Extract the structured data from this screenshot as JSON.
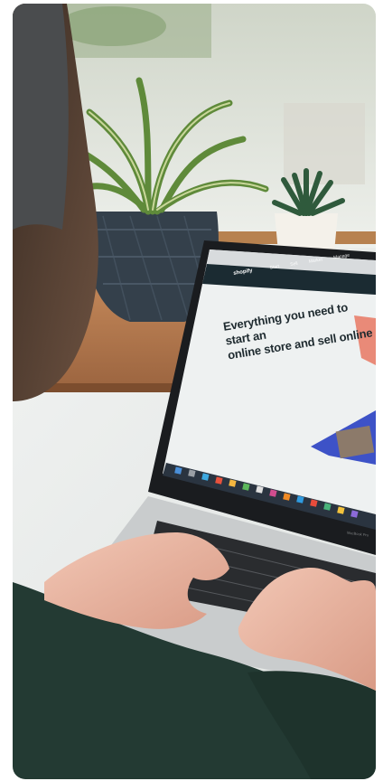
{
  "photo": {
    "subject": "laptop-on-desk-photo",
    "screen": {
      "brand": "shopify",
      "nav": [
        "Start",
        "Sell",
        "Market",
        "Manage"
      ],
      "headline_line1": "Everything you need to start an",
      "headline_line2": "online store and sell online"
    },
    "laptop_label": "MacBook Pro"
  },
  "colors": {
    "card_background": "#e9ebe8",
    "screen_header": "#1b2b32",
    "screen_accent_blue": "#3d52c7",
    "screen_accent_salmon": "#e98a78",
    "sweater": "#233a33"
  }
}
